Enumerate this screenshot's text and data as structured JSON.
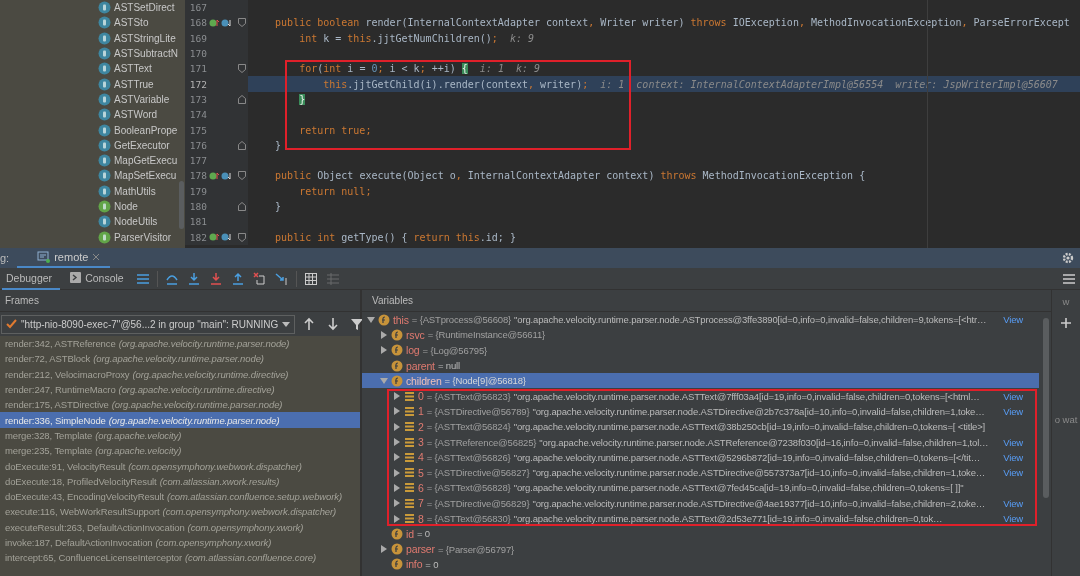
{
  "project_tree": {
    "items": [
      {
        "name": "ASTSetDirect",
        "kind": "class"
      },
      {
        "name": "ASTSto",
        "kind": "class"
      },
      {
        "name": "ASTStringLite",
        "kind": "class"
      },
      {
        "name": "ASTSubtractN",
        "kind": "class"
      },
      {
        "name": "ASTText",
        "kind": "class"
      },
      {
        "name": "ASTTrue",
        "kind": "class"
      },
      {
        "name": "ASTVariable",
        "kind": "class"
      },
      {
        "name": "ASTWord",
        "kind": "class"
      },
      {
        "name": "BooleanPrope",
        "kind": "class"
      },
      {
        "name": "GetExecutor",
        "kind": "class"
      },
      {
        "name": "MapGetExecu",
        "kind": "class"
      },
      {
        "name": "MapSetExecu",
        "kind": "class"
      },
      {
        "name": "MathUtils",
        "kind": "class"
      },
      {
        "name": "Node",
        "kind": "interface"
      },
      {
        "name": "NodeUtils",
        "kind": "class"
      },
      {
        "name": "ParserVisitor",
        "kind": "interface"
      }
    ]
  },
  "editor": {
    "lines": [
      {
        "number": "167",
        "current": false,
        "marker": false,
        "fold_start": false,
        "fold_end": false
      },
      {
        "number": "168",
        "current": false,
        "marker": true,
        "fold_start": true,
        "fold_end": false,
        "segments": [
          {
            "kind": "kw",
            "text": "    public boolean "
          },
          {
            "kind": "plain",
            "text": "render(InternalContextAdapter context"
          },
          {
            "kind": "kw",
            "text": ","
          },
          {
            "kind": "plain",
            "text": " Writer writer) "
          },
          {
            "kind": "kw",
            "text": "throws "
          },
          {
            "kind": "plain",
            "text": "IOException"
          },
          {
            "kind": "kw",
            "text": ","
          },
          {
            "kind": "plain",
            "text": " MethodInvocationException"
          },
          {
            "kind": "kw",
            "text": ","
          },
          {
            "kind": "plain",
            "text": " ParseErrorExcept"
          }
        ]
      },
      {
        "number": "169",
        "current": false,
        "marker": false,
        "fold_start": false,
        "fold_end": false,
        "segments": [
          {
            "kind": "kw",
            "text": "        int "
          },
          {
            "kind": "plain",
            "text": "k = "
          },
          {
            "kind": "kw",
            "text": "this"
          },
          {
            "kind": "plain",
            "text": ".jjtGetNumChildren()"
          },
          {
            "kind": "kw",
            "text": ";"
          },
          {
            "kind": "hint",
            "text": "  k: 9"
          }
        ]
      },
      {
        "number": "170",
        "current": false,
        "marker": false,
        "fold_start": false,
        "fold_end": false
      },
      {
        "number": "171",
        "current": false,
        "marker": false,
        "fold_start": true,
        "fold_end": false,
        "segments": [
          {
            "kind": "kw",
            "text": "        for"
          },
          {
            "kind": "plain",
            "text": "("
          },
          {
            "kind": "kw",
            "text": "int "
          },
          {
            "kind": "plain",
            "text": "i = "
          },
          {
            "kind": "num",
            "text": "0"
          },
          {
            "kind": "kw",
            "text": ";"
          },
          {
            "kind": "plain",
            "text": " i < k"
          },
          {
            "kind": "kw",
            "text": ";"
          },
          {
            "kind": "plain",
            "text": " ++i) "
          },
          {
            "kind": "match",
            "text": "{"
          },
          {
            "kind": "hint",
            "text": "  i: 1  k: 9"
          }
        ]
      },
      {
        "number": "172",
        "current": true,
        "marker": false,
        "fold_start": false,
        "fold_end": false,
        "segments": [
          {
            "kind": "kw",
            "text": "            this"
          },
          {
            "kind": "plain",
            "text": ".jjtGetChild(i).render(context"
          },
          {
            "kind": "kw",
            "text": ","
          },
          {
            "kind": "plain",
            "text": " writer)"
          },
          {
            "kind": "kw",
            "text": ";"
          },
          {
            "kind": "hint",
            "text": "  i: 1  context: InternalContextAdapterImpl@56554  writer: JspWriterImpl@56607"
          }
        ]
      },
      {
        "number": "173",
        "current": false,
        "marker": false,
        "fold_start": false,
        "fold_end": true,
        "segments": [
          {
            "kind": "match",
            "text": "        }"
          }
        ]
      },
      {
        "number": "174",
        "current": false,
        "marker": false,
        "fold_start": false,
        "fold_end": false
      },
      {
        "number": "175",
        "current": false,
        "marker": false,
        "fold_start": false,
        "fold_end": false,
        "segments": [
          {
            "kind": "kw",
            "text": "        return true;"
          }
        ]
      },
      {
        "number": "176",
        "current": false,
        "marker": false,
        "fold_start": false,
        "fold_end": true,
        "segments": [
          {
            "kind": "plain",
            "text": "    }"
          }
        ]
      },
      {
        "number": "177",
        "current": false,
        "marker": false,
        "fold_start": false,
        "fold_end": false
      },
      {
        "number": "178",
        "current": false,
        "marker": true,
        "fold_start": true,
        "fold_end": false,
        "segments": [
          {
            "kind": "kw",
            "text": "    public "
          },
          {
            "kind": "plain",
            "text": "Object execute(Object o"
          },
          {
            "kind": "kw",
            "text": ","
          },
          {
            "kind": "plain",
            "text": " InternalContextAdapter context) "
          },
          {
            "kind": "kw",
            "text": "throws "
          },
          {
            "kind": "plain",
            "text": "MethodInvocationException {"
          }
        ]
      },
      {
        "number": "179",
        "current": false,
        "marker": false,
        "fold_start": false,
        "fold_end": false,
        "segments": [
          {
            "kind": "kw",
            "text": "        return null;"
          }
        ]
      },
      {
        "number": "180",
        "current": false,
        "marker": false,
        "fold_start": false,
        "fold_end": true,
        "segments": [
          {
            "kind": "plain",
            "text": "    }"
          }
        ]
      },
      {
        "number": "181",
        "current": false,
        "marker": false,
        "fold_start": false,
        "fold_end": false
      },
      {
        "number": "182",
        "current": false,
        "marker": true,
        "fold_start": true,
        "fold_end": false,
        "segments": [
          {
            "kind": "kw",
            "text": "    public int "
          },
          {
            "kind": "plain",
            "text": "getType() { "
          },
          {
            "kind": "kw",
            "text": "return this"
          },
          {
            "kind": "plain",
            "text": ".id; }"
          }
        ]
      }
    ]
  },
  "debug_panel": {
    "label": "g:",
    "tabs": [
      {
        "label": "remote",
        "selected": true
      }
    ],
    "subtabs": [
      {
        "label": "Debugger",
        "selected": true
      },
      {
        "label": "Console",
        "selected": false
      }
    ],
    "frames": {
      "title": "Frames",
      "thread": "\"http-nio-8090-exec-7\"@56...2 in group \"main\": RUNNING",
      "items": [
        {
          "method": "render:342, ASTReference",
          "package": "(org.apache.velocity.runtime.parser.node)",
          "selected": false
        },
        {
          "method": "render:72, ASTBlock",
          "package": "(org.apache.velocity.runtime.parser.node)",
          "selected": false
        },
        {
          "method": "render:212, VelocimacroProxy",
          "package": "(org.apache.velocity.runtime.directive)",
          "selected": false
        },
        {
          "method": "render:247, RuntimeMacro",
          "package": "(org.apache.velocity.runtime.directive)",
          "selected": false
        },
        {
          "method": "render:175, ASTDirective",
          "package": "(org.apache.velocity.runtime.parser.node)",
          "selected": false
        },
        {
          "method": "render:336, SimpleNode",
          "package": "(org.apache.velocity.runtime.parser.node)",
          "selected": true
        },
        {
          "method": "merge:328, Template",
          "package": "(org.apache.velocity)",
          "selected": false
        },
        {
          "method": "merge:235, Template",
          "package": "(org.apache.velocity)",
          "selected": false
        },
        {
          "method": "doExecute:91, VelocityResult",
          "package": "(com.opensymphony.webwork.dispatcher)",
          "selected": false
        },
        {
          "method": "doExecute:18, ProfiledVelocityResult",
          "package": "(com.atlassian.xwork.results)",
          "selected": false
        },
        {
          "method": "doExecute:43, EncodingVelocityResult",
          "package": "(com.atlassian.confluence.setup.webwork)",
          "selected": false
        },
        {
          "method": "execute:116, WebWorkResultSupport",
          "package": "(com.opensymphony.webwork.dispatcher)",
          "selected": false
        },
        {
          "method": "executeResult:263, DefaultActionInvocation",
          "package": "(com.opensymphony.xwork)",
          "selected": false
        },
        {
          "method": "invoke:187, DefaultActionInvocation",
          "package": "(com.opensymphony.xwork)",
          "selected": false
        },
        {
          "method": "intercept:65, ConfluenceLicenseInterceptor",
          "package": "(com.atlassian.confluence.core)",
          "selected": false
        }
      ]
    },
    "variables": {
      "title": "Variables",
      "items": [
        {
          "name": "this",
          "kind": "field",
          "expanded": true,
          "selected": false,
          "type": "= {ASTprocess@56608}",
          "value": "\"org.apache.velocity.runtime.parser.node.ASTprocess@3ffe3890[id=0,info=0,invalid=false,children=9,tokens=[<htr…",
          "link": "View",
          "children": [
            {
              "name": "rsvc",
              "kind": "field",
              "expanded": false,
              "selected": false,
              "type": "= {RuntimeInstance@56611}"
            },
            {
              "name": "log",
              "kind": "field",
              "expanded": false,
              "selected": false,
              "type": "= {Log@56795}"
            },
            {
              "name": "parent",
              "kind": "field",
              "selected": false,
              "value": "= null"
            },
            {
              "name": "children",
              "kind": "field",
              "expanded": true,
              "selected": true,
              "type": "= {Node[9]@56818}",
              "children": [
                {
                  "name": "0",
                  "kind": "element",
                  "expanded": false,
                  "selected": false,
                  "type": "= {ASTText@56823}",
                  "value": "\"org.apache.velocity.runtime.parser.node.ASTText@7fff03a4[id=19,info=0,invalid=false,children=0,tokens=[<html…",
                  "link": "View"
                },
                {
                  "name": "1",
                  "kind": "element",
                  "expanded": false,
                  "selected": false,
                  "type": "= {ASTDirective@56789}",
                  "value": "\"org.apache.velocity.runtime.parser.node.ASTDirective@2b7c378a[id=10,info=0,invalid=false,children=1,toke…",
                  "link": "View"
                },
                {
                  "name": "2",
                  "kind": "element",
                  "expanded": false,
                  "selected": false,
                  "type": "= {ASTText@56824}",
                  "value": "\"org.apache.velocity.runtime.parser.node.ASTText@38b250cb[id=19,info=0,invalid=false,children=0,tokens=[        <title>]"
                },
                {
                  "name": "3",
                  "kind": "element",
                  "expanded": false,
                  "selected": false,
                  "type": "= {ASTReference@56825}",
                  "value": "\"org.apache.velocity.runtime.parser.node.ASTReference@7238f030[id=16,info=0,invalid=false,children=1,tol…",
                  "link": "View"
                },
                {
                  "name": "4",
                  "kind": "element",
                  "expanded": false,
                  "selected": false,
                  "type": "= {ASTText@56826}",
                  "value": "\"org.apache.velocity.runtime.parser.node.ASTText@5296b872[id=19,info=0,invalid=false,children=0,tokens=[</tit…",
                  "link": "View"
                },
                {
                  "name": "5",
                  "kind": "element",
                  "expanded": false,
                  "selected": false,
                  "type": "= {ASTDirective@56827}",
                  "value": "\"org.apache.velocity.runtime.parser.node.ASTDirective@557373a7[id=10,info=0,invalid=false,children=1,toke…",
                  "link": "View"
                },
                {
                  "name": "6",
                  "kind": "element",
                  "expanded": false,
                  "selected": false,
                  "type": "= {ASTText@56828}",
                  "value": "\"org.apache.velocity.runtime.parser.node.ASTText@7fed45ca[id=19,info=0,invalid=false,children=0,tokens=[        ]]\""
                },
                {
                  "name": "7",
                  "kind": "element",
                  "expanded": false,
                  "selected": false,
                  "type": "= {ASTDirective@56829}",
                  "value": "\"org.apache.velocity.runtime.parser.node.ASTDirective@4ae19377[id=10,info=0,invalid=false,children=2,toke…",
                  "link": "View"
                },
                {
                  "name": "8",
                  "kind": "element",
                  "expanded": false,
                  "selected": false,
                  "type": "= {ASTText@56830}",
                  "value": "\"org.apache.velocity.runtime.parser.node.ASTText@2d53e771[id=19,info=0,invalid=false,children=0,tok…",
                  "link": "View"
                }
              ]
            },
            {
              "name": "id",
              "kind": "field",
              "selected": false,
              "value": "= 0"
            },
            {
              "name": "parser",
              "kind": "field",
              "expanded": false,
              "selected": false,
              "type": "= {Parser@56797}"
            },
            {
              "name": "info",
              "kind": "field",
              "selected": false,
              "value": "= 0"
            }
          ]
        }
      ]
    },
    "watches": {
      "title": "w",
      "hint": "o wat"
    }
  }
}
